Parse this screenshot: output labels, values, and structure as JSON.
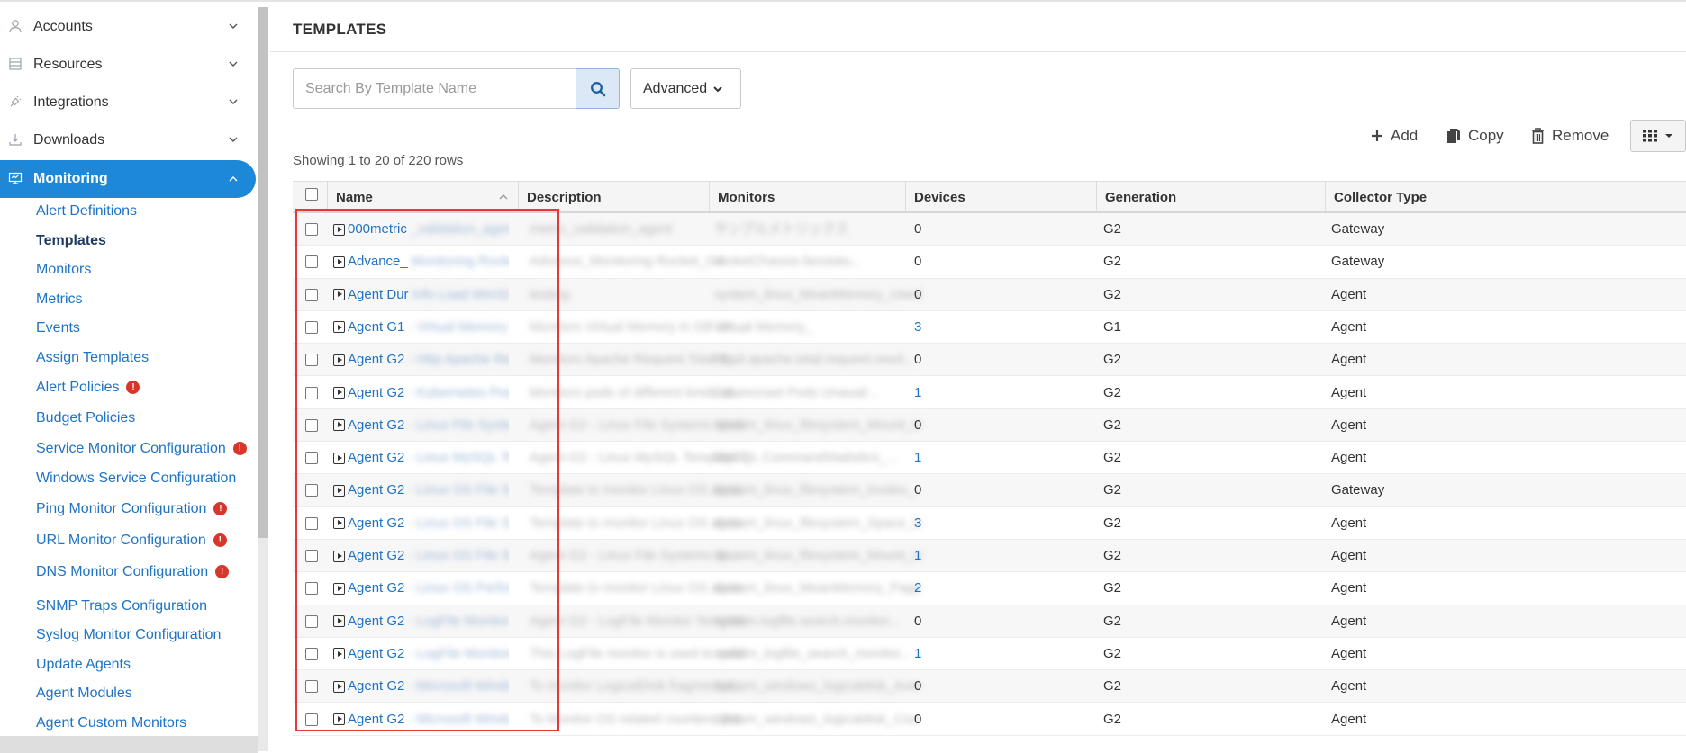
{
  "sidebar": {
    "nav": [
      {
        "label": "Accounts",
        "icon": "user-icon"
      },
      {
        "label": "Resources",
        "icon": "list-icon"
      },
      {
        "label": "Integrations",
        "icon": "plug-icon"
      },
      {
        "label": "Downloads",
        "icon": "download-icon"
      },
      {
        "label": "Monitoring",
        "icon": "monitor-icon"
      }
    ],
    "sub_items": [
      {
        "label": "Alert Definitions",
        "alert": false
      },
      {
        "label": "Templates",
        "alert": false,
        "current": true
      },
      {
        "label": "Monitors",
        "alert": false
      },
      {
        "label": "Metrics",
        "alert": false
      },
      {
        "label": "Events",
        "alert": false
      },
      {
        "label": "Assign Templates",
        "alert": false
      },
      {
        "label": "Alert Policies",
        "alert": true
      },
      {
        "label": "Budget Policies",
        "alert": false
      },
      {
        "label": "Service Monitor Configuration",
        "alert": true
      },
      {
        "label": "Windows Service Configuration",
        "alert": false
      },
      {
        "label": "Ping Monitor Configuration",
        "alert": true
      },
      {
        "label": "URL Monitor Configuration",
        "alert": true
      },
      {
        "label": "DNS Monitor Configuration",
        "alert": true
      },
      {
        "label": "SNMP Traps Configuration",
        "alert": false
      },
      {
        "label": "Syslog Monitor Configuration",
        "alert": false
      },
      {
        "label": "Update Agents",
        "alert": false
      },
      {
        "label": "Agent Modules",
        "alert": false
      },
      {
        "label": "Agent Custom Monitors",
        "alert": false
      }
    ],
    "alert_glyph": "!"
  },
  "main": {
    "title": "TEMPLATES",
    "search": {
      "placeholder": "Search By Template Name"
    },
    "advanced_label": "Advanced",
    "toolbar": {
      "add": "Add",
      "copy": "Copy",
      "remove": "Remove"
    },
    "showing": "Showing 1 to 20 of 220 rows",
    "columns": [
      "Name",
      "Description",
      "Monitors",
      "Devices",
      "Generation",
      "Collector Type"
    ],
    "rows": [
      {
        "name": "000metric",
        "name_rest": "_validation_agent",
        "desc": "metric_validation_agent",
        "monitors": "サンプルメトリックス",
        "devices": "0",
        "gen": "G2",
        "collector": "Gateway"
      },
      {
        "name": "Advance_",
        "name_rest": "Monitoring Rocket_G4",
        "desc": "Advance_Monitoring Rocket_G4",
        "monitors": "rocketChassis.fanstatu...",
        "devices": "0",
        "gen": "G2",
        "collector": "Gateway"
      },
      {
        "name": "Agent Dur",
        "name_rest": "Info Load Win32 R&D",
        "desc": "testing",
        "monitors": "system_linux_MeanMemory_Used_...",
        "devices": "0",
        "gen": "G2",
        "collector": "Agent"
      },
      {
        "name": "Agent G1",
        "name_rest": "- Virtual Memory in GB",
        "desc": "Monitors Virtual Memory in GB on ...",
        "monitors": "Virtual Memory_",
        "devices": "3",
        "gen": "G1",
        "collector": "Agent"
      },
      {
        "name": "Agent G2",
        "name_rest": "- Http Apache Request",
        "desc": "Monitors Apache Request Total ti...",
        "monitors": "httpd.apache.total.request.resol...",
        "devices": "0",
        "gen": "G2",
        "collector": "Agent"
      },
      {
        "name": "Agent G2",
        "name_rest": "- Kubernetes Pods Mon",
        "desc": "Monitors pods of different kinds of...",
        "monitors": "Daemonset Pods Unavail...",
        "devices": "1",
        "gen": "G2",
        "collector": "Agent"
      },
      {
        "name": "Agent G2",
        "name_rest": "- Linux File System M",
        "desc": "Agent G2 - Linux File Systems Moni...",
        "monitors": "system_linux_filesystem_Mount_U...",
        "devices": "0",
        "gen": "G2",
        "collector": "Agent"
      },
      {
        "name": "Agent G2",
        "name_rest": "- Linux MySQL Template",
        "desc": "Agent G2 - Linux MySQL Template T...",
        "monitors": "MySQL CommandStatistics_...",
        "devices": "1",
        "gen": "G2",
        "collector": "Agent"
      },
      {
        "name": "Agent G2",
        "name_rest": "- Linux OS File Systems",
        "desc": "Template to monitor Linux OS abou...",
        "monitors": "system_linux_filesystem_inodes_...",
        "devices": "0",
        "gen": "G2",
        "collector": "Gateway"
      },
      {
        "name": "Agent G2",
        "name_rest": "- Linux OS File Systems",
        "desc": "Template to monitor Linux OS abou...",
        "monitors": "system_linux_filesystem_Space_U...",
        "devices": "3",
        "gen": "G2",
        "collector": "Agent"
      },
      {
        "name": "Agent G2",
        "name_rest": "- Linux OS File Systems",
        "desc": "Agent G2 - Linux File Systems M...",
        "monitors": "system_linux_filesystem_Mount_U...",
        "devices": "1",
        "gen": "G2",
        "collector": "Agent"
      },
      {
        "name": "Agent G2",
        "name_rest": "- Linux OS Performance",
        "desc": "Template to monitor Linux OS abou...",
        "monitors": "system_linux_MeanMemory_PageFi...",
        "devices": "2",
        "gen": "G2",
        "collector": "Agent"
      },
      {
        "name": "Agent G2",
        "name_rest": "- LogFile Monitor Temp",
        "desc": "Agent G2 - LogFile Monitor Template",
        "monitors": "system.logfile.search.monitor...",
        "devices": "0",
        "gen": "G2",
        "collector": "Agent"
      },
      {
        "name": "Agent G2",
        "name_rest": "- LogFile Monitoring",
        "desc": "This LogFile monitor is used to valid...",
        "monitors": "system_logfile_search_monitor...",
        "devices": "1",
        "gen": "G2",
        "collector": "Agent"
      },
      {
        "name": "Agent G2",
        "name_rest": "- Microsoft Windows L",
        "desc": "To monitor LogicalDisk fragmentat...",
        "monitors": "system_windows_logicaldisk_Aver...",
        "devices": "0",
        "gen": "G2",
        "collector": "Agent"
      },
      {
        "name": "Agent G2",
        "name_rest": "- Microsoft Windows O",
        "desc": "To Monitor OS related counters like...",
        "monitors": "system_windows_logicaldisk_Cou...",
        "devices": "0",
        "gen": "G2",
        "collector": "Agent"
      }
    ]
  },
  "colors": {
    "accent": "#1e88d8",
    "link": "#1f73c4",
    "highlight": "#e53935",
    "alert": "#d9362b"
  }
}
